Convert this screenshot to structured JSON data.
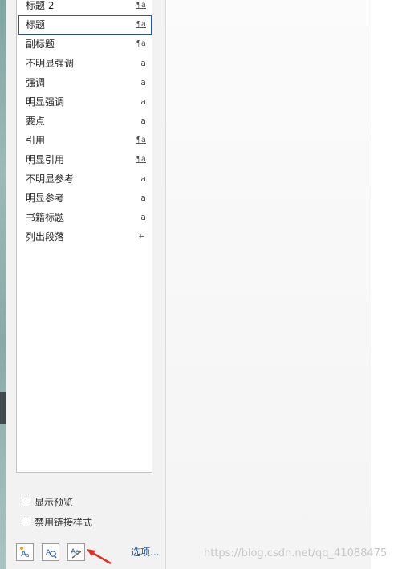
{
  "styles_list": {
    "items": [
      {
        "label": "标题 2",
        "mark": "¶a",
        "kind": "pa",
        "selected": false
      },
      {
        "label": "标题",
        "mark": "¶a",
        "kind": "pa",
        "selected": true
      },
      {
        "label": "副标题",
        "mark": "¶a",
        "kind": "pa",
        "selected": false
      },
      {
        "label": "不明显强调",
        "mark": "a",
        "kind": "char",
        "selected": false
      },
      {
        "label": "强调",
        "mark": "a",
        "kind": "char",
        "selected": false
      },
      {
        "label": "明显强调",
        "mark": "a",
        "kind": "char",
        "selected": false
      },
      {
        "label": "要点",
        "mark": "a",
        "kind": "char",
        "selected": false
      },
      {
        "label": "引用",
        "mark": "¶a",
        "kind": "pa",
        "selected": false
      },
      {
        "label": "明显引用",
        "mark": "¶a",
        "kind": "pa",
        "selected": false
      },
      {
        "label": "不明显参考",
        "mark": "a",
        "kind": "char",
        "selected": false
      },
      {
        "label": "明显参考",
        "mark": "a",
        "kind": "char",
        "selected": false
      },
      {
        "label": "书籍标题",
        "mark": "a",
        "kind": "char",
        "selected": false
      },
      {
        "label": "列出段落",
        "mark": "↵",
        "kind": "para",
        "selected": false
      }
    ]
  },
  "options": {
    "show_preview": "显示预览",
    "disable_linked_styles": "禁用链接样式"
  },
  "footer": {
    "options_link": "选项..."
  },
  "watermark": "https://blog.csdn.net/qq_41088475",
  "colors": {
    "selection_border": "#2b579a",
    "arrow": "#e0301e"
  }
}
